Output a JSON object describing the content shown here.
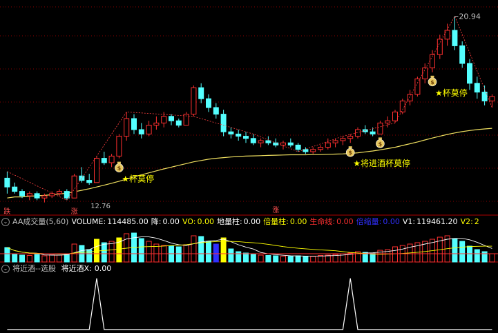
{
  "colors": {
    "up": "#ff3030",
    "down": "#54ffff",
    "ma": "#f0e060",
    "yellow": "#ffff00",
    "magenta": "#ff40ff",
    "grid": "#8b0000",
    "white": "#ffffff"
  },
  "icons": {
    "marker": "money-bag-icon",
    "star": "star-icon",
    "collapse": "chevron-down-icon"
  },
  "chart_data": [
    {
      "type": "candlestick",
      "panel": "price",
      "high_label": "20.94",
      "low_label": "12.76",
      "annotations": [
        {
          "text": "★杯莫停",
          "index": 15
        },
        {
          "text": "★将进酒杯莫停",
          "index": 46
        },
        {
          "text": "★杯莫停",
          "index": 57
        }
      ],
      "side_marks": [
        {
          "text": "涨",
          "index": 9
        },
        {
          "text": "跌",
          "index": 0
        },
        {
          "text": "涨",
          "index": 36
        }
      ],
      "signal_icons": [
        15,
        46,
        50,
        57
      ],
      "ohlc": [
        [
          13.6,
          13.9,
          12.9,
          13.2
        ],
        [
          13.2,
          13.4,
          12.9,
          13.0
        ],
        [
          13.0,
          13.1,
          12.7,
          12.8
        ],
        [
          12.8,
          13.0,
          12.6,
          12.9
        ],
        [
          12.9,
          13.0,
          12.6,
          12.7
        ],
        [
          12.7,
          12.9,
          12.5,
          12.8
        ],
        [
          12.8,
          13.0,
          12.7,
          12.9
        ],
        [
          12.9,
          13.1,
          12.8,
          13.0
        ],
        [
          13.0,
          13.1,
          12.6,
          12.7
        ],
        [
          12.7,
          13.8,
          12.7,
          13.7
        ],
        [
          13.7,
          14.1,
          13.4,
          13.5
        ],
        [
          13.5,
          13.8,
          13.3,
          13.4
        ],
        [
          13.4,
          14.6,
          13.4,
          14.5
        ],
        [
          14.5,
          14.8,
          14.2,
          14.3
        ],
        [
          14.3,
          14.7,
          14.1,
          14.6
        ],
        [
          14.6,
          15.6,
          14.5,
          15.5
        ],
        [
          15.5,
          16.6,
          15.3,
          16.3
        ],
        [
          16.3,
          16.5,
          15.6,
          15.8
        ],
        [
          15.8,
          16.1,
          15.4,
          15.6
        ],
        [
          15.6,
          16.2,
          15.5,
          16.0
        ],
        [
          16.0,
          16.4,
          15.8,
          16.1
        ],
        [
          16.1,
          16.6,
          15.9,
          16.4
        ],
        [
          16.4,
          16.5,
          16.0,
          16.2
        ],
        [
          16.2,
          16.3,
          15.9,
          16.0
        ],
        [
          16.0,
          16.6,
          16.0,
          16.5
        ],
        [
          16.5,
          17.8,
          16.4,
          17.7
        ],
        [
          17.7,
          17.9,
          17.0,
          17.2
        ],
        [
          17.2,
          17.4,
          16.6,
          16.8
        ],
        [
          16.8,
          17.0,
          16.3,
          16.5
        ],
        [
          16.5,
          16.7,
          15.5,
          15.7
        ],
        [
          15.7,
          15.9,
          15.4,
          15.6
        ],
        [
          15.6,
          15.8,
          15.3,
          15.5
        ],
        [
          15.5,
          15.7,
          15.2,
          15.4
        ],
        [
          15.4,
          15.6,
          15.1,
          15.2
        ],
        [
          15.2,
          15.4,
          15.0,
          15.3
        ],
        [
          15.3,
          15.5,
          15.1,
          15.2
        ],
        [
          15.2,
          15.4,
          15.0,
          15.1
        ],
        [
          15.1,
          15.3,
          14.9,
          15.2
        ],
        [
          15.2,
          15.4,
          15.0,
          15.1
        ],
        [
          15.1,
          15.2,
          14.8,
          14.9
        ],
        [
          14.9,
          15.0,
          14.7,
          14.8
        ],
        [
          14.8,
          15.0,
          14.7,
          14.9
        ],
        [
          14.9,
          15.1,
          14.8,
          15.0
        ],
        [
          15.0,
          15.4,
          14.9,
          15.2
        ],
        [
          15.2,
          15.4,
          15.0,
          15.3
        ],
        [
          15.3,
          15.5,
          15.1,
          15.4
        ],
        [
          15.4,
          15.6,
          15.2,
          15.5
        ],
        [
          15.5,
          15.9,
          15.4,
          15.8
        ],
        [
          15.8,
          16.0,
          15.6,
          15.7
        ],
        [
          15.7,
          15.9,
          15.5,
          15.6
        ],
        [
          15.6,
          16.2,
          15.6,
          16.1
        ],
        [
          16.1,
          16.4,
          15.9,
          16.2
        ],
        [
          16.2,
          16.7,
          16.1,
          16.6
        ],
        [
          16.6,
          17.2,
          16.5,
          17.1
        ],
        [
          17.1,
          17.6,
          16.9,
          17.4
        ],
        [
          17.4,
          18.2,
          17.3,
          18.1
        ],
        [
          18.1,
          18.8,
          17.9,
          18.6
        ],
        [
          18.6,
          19.4,
          18.4,
          19.2
        ],
        [
          19.2,
          20.1,
          19.0,
          19.9
        ],
        [
          19.9,
          20.6,
          19.6,
          20.3
        ],
        [
          20.3,
          20.94,
          19.4,
          19.6
        ],
        [
          19.6,
          19.8,
          18.6,
          18.8
        ],
        [
          18.8,
          19.0,
          17.6,
          17.9
        ],
        [
          17.9,
          18.2,
          17.2,
          17.5
        ],
        [
          17.5,
          17.8,
          16.9,
          17.1
        ],
        [
          17.1,
          17.4,
          16.8,
          17.3
        ]
      ],
      "ma": [
        12.7,
        12.75,
        12.75,
        12.78,
        12.8,
        12.82,
        12.85,
        12.88,
        12.92,
        12.98,
        13.05,
        13.12,
        13.2,
        13.28,
        13.37,
        13.46,
        13.56,
        13.66,
        13.75,
        13.84,
        13.93,
        14.02,
        14.1,
        14.18,
        14.26,
        14.34,
        14.4,
        14.46,
        14.5,
        14.53,
        14.56,
        14.58,
        14.6,
        14.61,
        14.62,
        14.63,
        14.64,
        14.65,
        14.66,
        14.66,
        14.66,
        14.67,
        14.67,
        14.68,
        14.69,
        14.7,
        14.72,
        14.75,
        14.79,
        14.83,
        14.88,
        14.94,
        15.0,
        15.08,
        15.16,
        15.24,
        15.33,
        15.42,
        15.5,
        15.58,
        15.65,
        15.71,
        15.76,
        15.8,
        15.83,
        15.86
      ],
      "ylim": [
        12.3,
        21.3
      ]
    },
    {
      "type": "bar",
      "panel": "volume",
      "title": "AA成交量(5,60)",
      "fields": [
        {
          "label": "VOLUME:",
          "value": "114485.00",
          "color": "#ffffff"
        },
        {
          "label": "降:",
          "value": "0.00",
          "color": "#ffffff"
        },
        {
          "label": "VO:",
          "value": "0.00",
          "color": "#ffff00"
        },
        {
          "label": "地量柱:",
          "value": "0.00",
          "color": "#ffffff"
        },
        {
          "label": "倍量柱:",
          "value": "0.00",
          "color": "#ffff00"
        },
        {
          "label": "生命线:",
          "value": "0.00",
          "color": "#ff3030"
        },
        {
          "label": "倍缩量:",
          "value": "0.00",
          "color": "#3030ff"
        },
        {
          "label": "V1:",
          "value": "119461.20",
          "color": "#ffffff"
        },
        {
          "label": "V2:",
          "value": "2",
          "color": "#ffff00"
        }
      ],
      "values": [
        210,
        120,
        100,
        95,
        110,
        90,
        105,
        100,
        120,
        260,
        240,
        180,
        330,
        280,
        300,
        350,
        410,
        420,
        340,
        300,
        260,
        240,
        230,
        220,
        250,
        380,
        370,
        300,
        260,
        350,
        190,
        150,
        130,
        120,
        100,
        95,
        90,
        85,
        80,
        90,
        85,
        80,
        95,
        100,
        110,
        120,
        130,
        150,
        140,
        125,
        170,
        180,
        220,
        240,
        260,
        280,
        300,
        330,
        360,
        380,
        340,
        300,
        230,
        180,
        150,
        120
      ],
      "yellow_idx": [
        12,
        15,
        29
      ],
      "blue_idx": [
        28
      ],
      "ylim": [
        0,
        480
      ]
    },
    {
      "type": "line",
      "panel": "signal",
      "title": "将近酒--选股",
      "fields": [
        {
          "label": "将近酒X:",
          "value": "0.00"
        }
      ],
      "values": [
        0,
        0,
        0,
        0,
        0,
        0,
        0,
        0,
        0,
        0,
        0,
        0,
        1,
        0,
        0,
        0,
        0,
        0,
        0,
        0,
        0,
        0,
        0,
        0,
        0,
        0,
        0,
        0,
        0,
        0,
        0,
        0,
        0,
        0,
        0,
        0,
        0,
        0,
        0,
        0,
        0,
        0,
        0,
        0,
        0,
        0,
        1,
        0,
        0,
        0,
        0,
        0,
        0,
        0,
        0,
        0,
        0,
        0,
        0,
        0,
        0,
        0,
        0,
        0,
        0,
        0
      ],
      "ylim": [
        0,
        1.05
      ]
    }
  ]
}
